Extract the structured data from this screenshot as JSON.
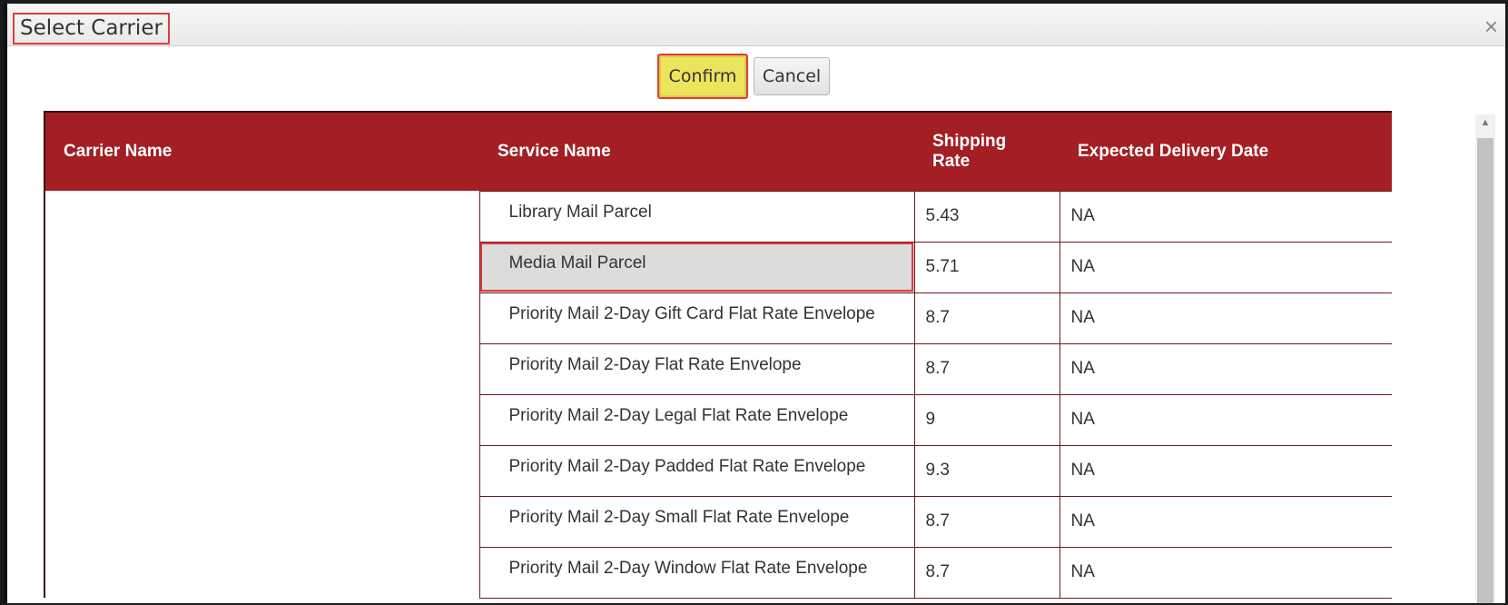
{
  "dialog": {
    "title": "Select Carrier",
    "close_glyph": "×"
  },
  "buttons": {
    "confirm_label": "Confirm",
    "cancel_label": "Cancel"
  },
  "table": {
    "headers": {
      "carrier_name": "Carrier Name",
      "service_name": "Service Name",
      "shipping_rate": "Shipping Rate",
      "expected_delivery": "Expected Delivery Date"
    },
    "rows": [
      {
        "service": "Library Mail Parcel",
        "rate": "5.43",
        "delivery": "NA"
      },
      {
        "service": "Media Mail Parcel",
        "rate": "5.71",
        "delivery": "NA"
      },
      {
        "service": "Priority Mail 2-Day Gift Card Flat Rate Envelope",
        "rate": "8.7",
        "delivery": "NA"
      },
      {
        "service": "Priority Mail 2-Day Flat Rate Envelope",
        "rate": "8.7",
        "delivery": "NA"
      },
      {
        "service": "Priority Mail 2-Day Legal Flat Rate Envelope",
        "rate": "9",
        "delivery": "NA"
      },
      {
        "service": "Priority Mail 2-Day Padded Flat Rate Envelope",
        "rate": "9.3",
        "delivery": "NA"
      },
      {
        "service": "Priority Mail 2-Day Small Flat Rate Envelope",
        "rate": "8.7",
        "delivery": "NA"
      },
      {
        "service": "Priority Mail 2-Day Window Flat Rate Envelope",
        "rate": "8.7",
        "delivery": "NA"
      }
    ]
  },
  "scrollbar": {
    "up_arrow_icon": "chevron-up-icon"
  }
}
